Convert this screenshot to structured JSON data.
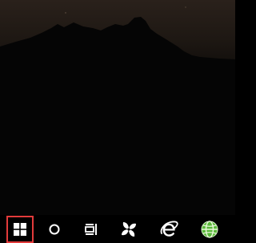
{
  "desktop": {
    "wallpaper": "night-mountain-silhouette"
  },
  "taskbar": {
    "items": [
      {
        "name": "windows-start",
        "icon": "windows-logo-icon",
        "highlighted": true,
        "highlight_color": "#e23b3b"
      },
      {
        "name": "search",
        "icon": "search-circle-icon"
      },
      {
        "name": "task-view",
        "icon": "task-view-icon"
      },
      {
        "name": "pinwheel-app",
        "icon": "pinwheel-icon"
      },
      {
        "name": "internet-explorer",
        "icon": "internet-explorer-icon"
      },
      {
        "name": "green-globe-app",
        "icon": "green-globe-icon"
      }
    ]
  },
  "colors": {
    "highlight": "#e23b3b",
    "icon_white": "#ffffff",
    "globe_green": "#5ab83a"
  }
}
